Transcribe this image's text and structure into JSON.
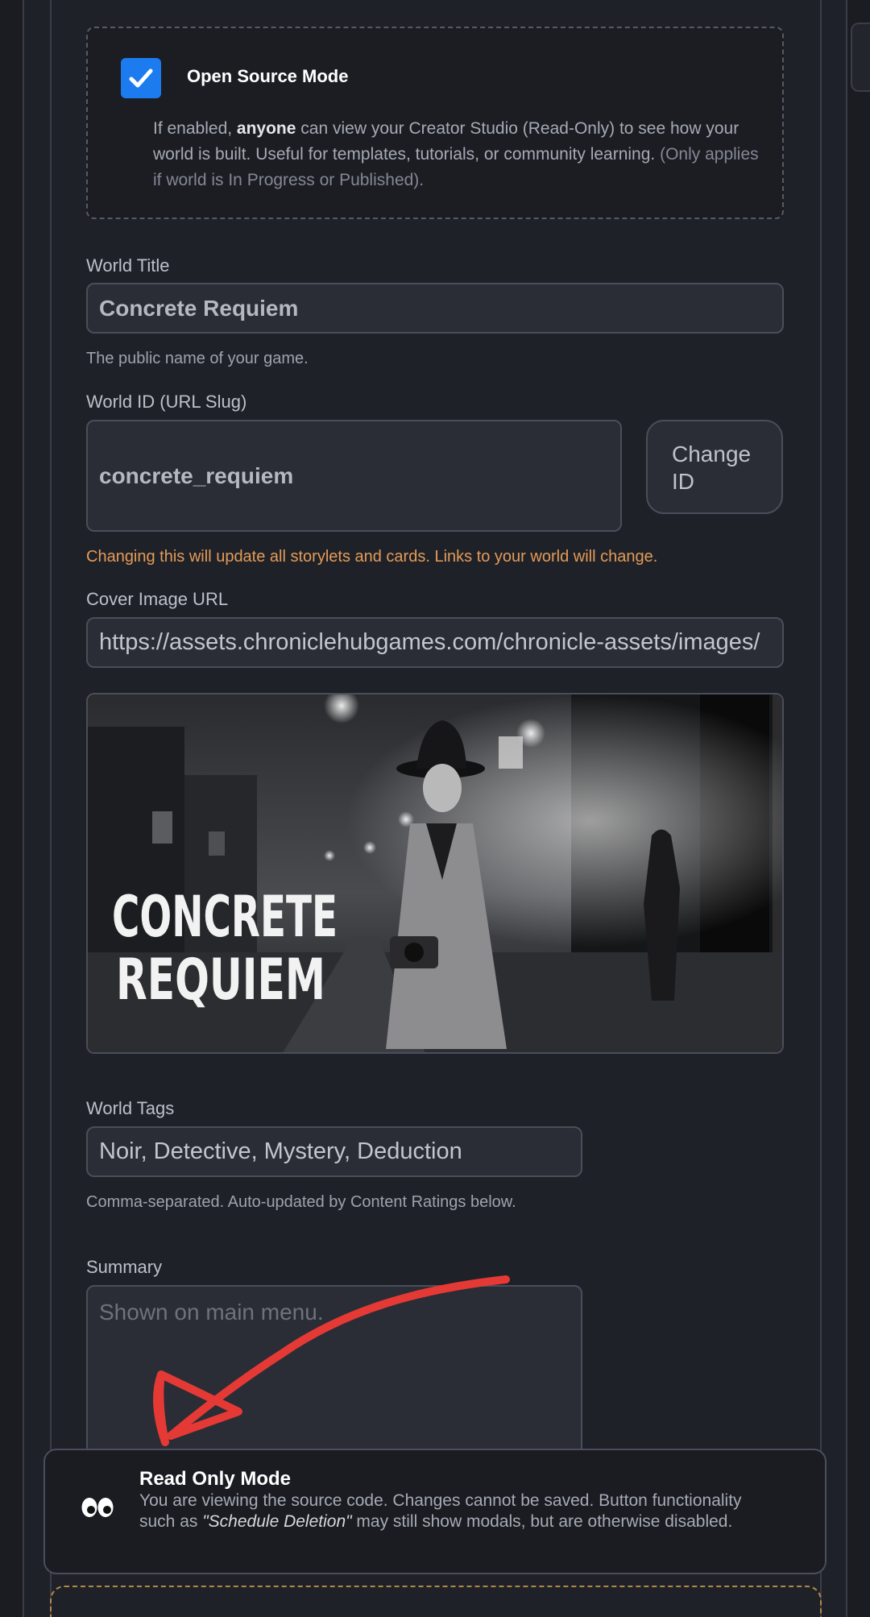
{
  "open_source": {
    "checked": true,
    "title": "Open Source Mode",
    "desc_before": "If enabled, ",
    "desc_bold": "anyone",
    "desc_after": " can view your Creator Studio (Read-Only) to see how your world is built. Useful for templates, tutorials, or community learning.",
    "desc_note": "(Only applies if world is In Progress or Published)."
  },
  "world_title": {
    "label": "World Title",
    "value": "Concrete Requiem",
    "help": "The public name of your game."
  },
  "world_id": {
    "label": "World ID (URL Slug)",
    "value": "concrete_requiem",
    "button_line1": "Change",
    "button_line2": "ID",
    "warning": "Changing this will update all storylets and cards. Links to your world will change."
  },
  "cover": {
    "label": "Cover Image URL",
    "value": "https://assets.chroniclehubgames.com/chronicle-assets/images/",
    "image_title_line1": "CONCRETE",
    "image_title_line2": "REQUIEM"
  },
  "tags": {
    "label": "World Tags",
    "value": "Noir, Detective, Mystery, Deduction",
    "help": "Comma-separated. Auto-updated by Content Ratings below."
  },
  "summary": {
    "label": "Summary",
    "placeholder": "Shown on main menu."
  },
  "read_only": {
    "icon": "eyes-icon",
    "title": "Read Only Mode",
    "text_before": "You are viewing the source code. Changes cannot be saved. Button functionality such as ",
    "text_italic": "\"Schedule Deletion\"",
    "text_after": " may still show modals, but are otherwise disabled."
  },
  "colors": {
    "accent": "#1d7bf0",
    "warning": "#e39b58",
    "annotation": "#e53935"
  }
}
